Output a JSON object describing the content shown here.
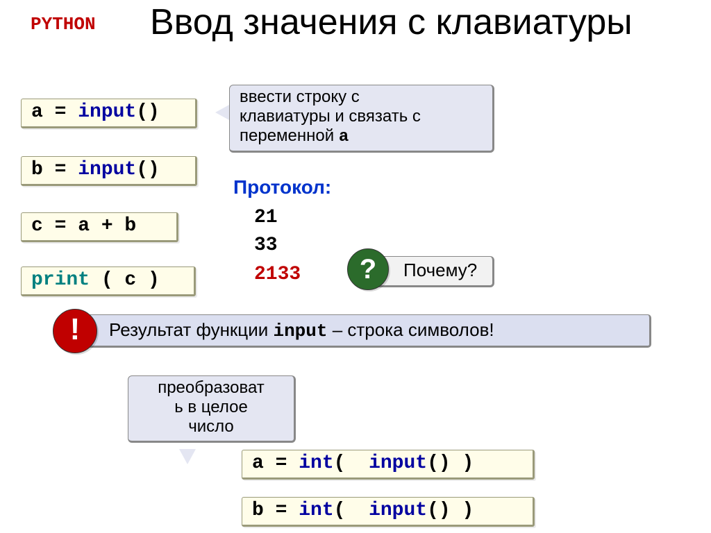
{
  "label_python": "Python",
  "title": "Ввод значения с клавиатуры",
  "code": {
    "box1": {
      "a": "a = ",
      "fn": "input",
      "rest": "()"
    },
    "box2": {
      "a": "b = ",
      "fn": "input",
      "rest": "()"
    },
    "box3": "c = a + b",
    "box4": {
      "fn": "print",
      "rest": " ( c )"
    },
    "box5": {
      "lead": "a = ",
      "cast": "int",
      "mid": "(  ",
      "fn": "input",
      "rest": "() )"
    },
    "box6": {
      "lead": "b = ",
      "cast": "int",
      "mid": "(  ",
      "fn": "input",
      "rest": "() )"
    }
  },
  "callout_input": {
    "l1": "ввести строку с",
    "l2": "клавиатуры и связать с",
    "l3_a": "переменной ",
    "l3_b": "a"
  },
  "proto_label": "Протокол:",
  "proto_vals": [
    "21",
    "33",
    "2133"
  ],
  "why": {
    "q": "?",
    "text": "Почему?"
  },
  "result": {
    "t1": "Результат функции ",
    "fn": "input",
    "t2": " – строка символов!"
  },
  "excl": "!",
  "callout_int": {
    "l1": "преобразоват",
    "l2": "ь в целое",
    "l3": "число"
  }
}
